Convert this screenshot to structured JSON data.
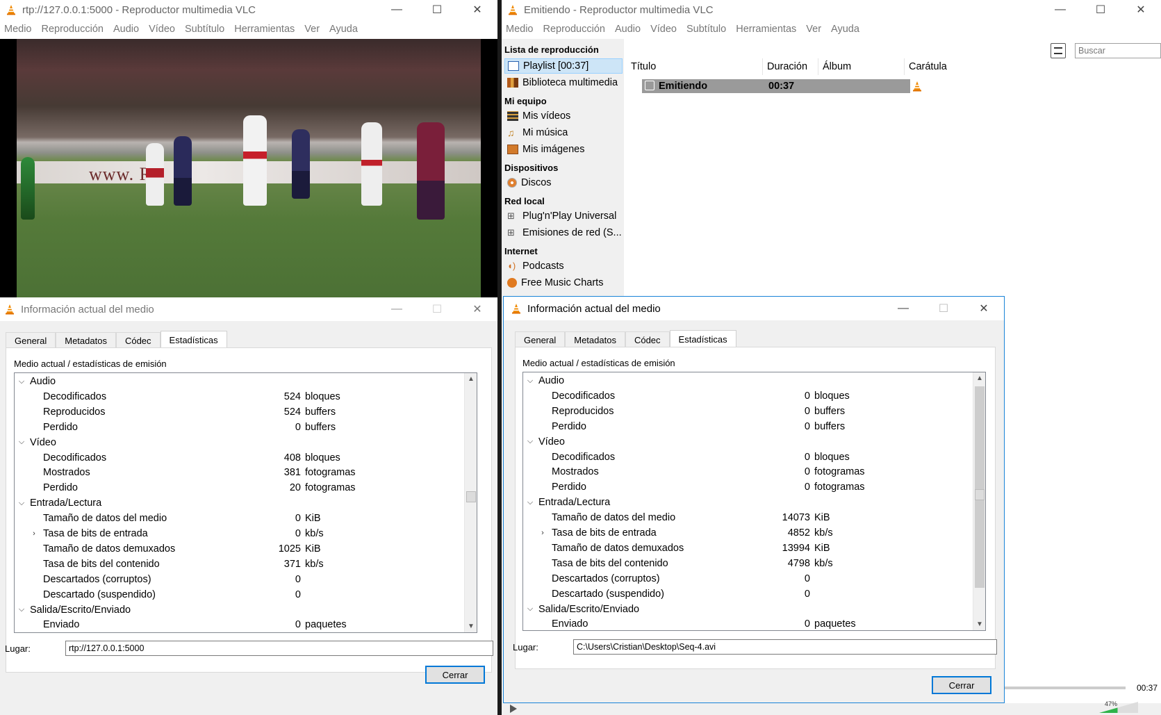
{
  "left_window": {
    "title": "rtp://127.0.0.1:5000 - Reproductor multimedia VLC",
    "menu": [
      "Medio",
      "Reproducción",
      "Audio",
      "Vídeo",
      "Subtítulo",
      "Herramientas",
      "Ver",
      "Ayuda"
    ],
    "ad_text": "www. RE"
  },
  "right_window": {
    "title": "Emitiendo - Reproductor multimedia VLC",
    "menu": [
      "Medio",
      "Reproducción",
      "Audio",
      "Vídeo",
      "Subtítulo",
      "Herramientas",
      "Ver",
      "Ayuda"
    ],
    "search_placeholder": "Buscar",
    "sidebar": {
      "playlist_header": "Lista de reproducción",
      "playlist_item": "Playlist [00:37]",
      "media_library": "Biblioteca multimedia",
      "my_computer": "Mi equipo",
      "my_videos": "Mis vídeos",
      "my_music": "Mi música",
      "my_images": "Mis imágenes",
      "devices": "Dispositivos",
      "discs": "Discos",
      "local_network": "Red local",
      "upnp": "Plug'n'Play Universal",
      "network_streams": "Emisiones de red (S...",
      "internet": "Internet",
      "podcasts": "Podcasts",
      "free_music_charts": "Free Music Charts"
    },
    "columns": [
      "Título",
      "Duración",
      "Álbum",
      "Carátula"
    ],
    "row": {
      "title": "Emitiendo",
      "duration": "00:37"
    },
    "time": "00:37",
    "volume": "47%"
  },
  "dialog_left": {
    "title": "Información actual del medio",
    "tabs": [
      "General",
      "Metadatos",
      "Códec",
      "Estadísticas"
    ],
    "subhead": "Medio actual / estadísticas de emisión",
    "sections": {
      "audio": "Audio",
      "video": "Vídeo",
      "input": "Entrada/Lectura",
      "output": "Salida/Escrito/Enviado"
    },
    "rows": [
      {
        "label": "Decodificados",
        "value": "524",
        "unit": "bloques"
      },
      {
        "label": "Reproducidos",
        "value": "524",
        "unit": "buffers"
      },
      {
        "label": "Perdido",
        "value": "0",
        "unit": "buffers"
      },
      {
        "label": "Decodificados",
        "value": "408",
        "unit": "bloques"
      },
      {
        "label": "Mostrados",
        "value": "381",
        "unit": "fotogramas"
      },
      {
        "label": "Perdido",
        "value": "20",
        "unit": "fotogramas"
      },
      {
        "label": "Tamaño de datos del medio",
        "value": "0",
        "unit": "KiB"
      },
      {
        "label": "Tasa de bits de entrada",
        "value": "0",
        "unit": "kb/s"
      },
      {
        "label": "Tamaño de datos demuxados",
        "value": "1025",
        "unit": "KiB"
      },
      {
        "label": "Tasa de bits del contenido",
        "value": "371",
        "unit": "kb/s"
      },
      {
        "label": "Descartados (corruptos)",
        "value": "0",
        "unit": ""
      },
      {
        "label": "Descartado (suspendido)",
        "value": "0",
        "unit": ""
      },
      {
        "label": "Enviado",
        "value": "0",
        "unit": "paquetes"
      }
    ],
    "lugar_label": "Lugar:",
    "lugar_value": "rtp://127.0.0.1:5000",
    "close": "Cerrar"
  },
  "dialog_right": {
    "title": "Información actual del medio",
    "tabs": [
      "General",
      "Metadatos",
      "Códec",
      "Estadísticas"
    ],
    "subhead": "Medio actual / estadísticas de emisión",
    "sections": {
      "audio": "Audio",
      "video": "Vídeo",
      "input": "Entrada/Lectura",
      "output": "Salida/Escrito/Enviado"
    },
    "rows": [
      {
        "label": "Decodificados",
        "value": "0",
        "unit": "bloques"
      },
      {
        "label": "Reproducidos",
        "value": "0",
        "unit": "buffers"
      },
      {
        "label": "Perdido",
        "value": "0",
        "unit": "buffers"
      },
      {
        "label": "Decodificados",
        "value": "0",
        "unit": "bloques"
      },
      {
        "label": "Mostrados",
        "value": "0",
        "unit": "fotogramas"
      },
      {
        "label": "Perdido",
        "value": "0",
        "unit": "fotogramas"
      },
      {
        "label": "Tamaño de datos del medio",
        "value": "14073",
        "unit": "KiB"
      },
      {
        "label": "Tasa de bits de entrada",
        "value": "4852",
        "unit": "kb/s"
      },
      {
        "label": "Tamaño de datos demuxados",
        "value": "13994",
        "unit": "KiB"
      },
      {
        "label": "Tasa de bits del contenido",
        "value": "4798",
        "unit": "kb/s"
      },
      {
        "label": "Descartados (corruptos)",
        "value": "0",
        "unit": ""
      },
      {
        "label": "Descartado (suspendido)",
        "value": "0",
        "unit": ""
      },
      {
        "label": "Enviado",
        "value": "0",
        "unit": "paquetes"
      }
    ],
    "lugar_label": "Lugar:",
    "lugar_value": "C:\\Users\\Cristian\\Desktop\\Seq-4.avi",
    "close": "Cerrar"
  },
  "colors": {
    "vlc_orange": "#f08a00",
    "selection": "#cde5f7",
    "accent": "#0078d7"
  }
}
